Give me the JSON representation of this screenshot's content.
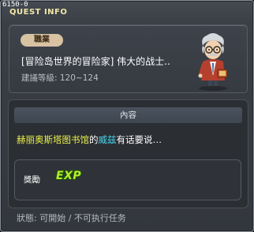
{
  "window": {
    "quest_id": "6150-0",
    "title": "QUEST INFO"
  },
  "quest": {
    "job_badge": "職業",
    "name": "[冒险岛世界的冒险家] 伟大的战士..",
    "level_req": "建議等級: 120~124",
    "npc_icon": "old-scholar-npc-icon"
  },
  "content": {
    "header": "內容",
    "text_parts": {
      "location": "赫丽奥斯塔图书馆",
      "connector": "的",
      "npc_name": "威兹",
      "tail": "有话要说…"
    },
    "reward_label": "獎勵",
    "reward_exp": "EXP"
  },
  "status": {
    "text": "狀態: 可開始 / 不可执行任务"
  },
  "colors": {
    "accent_yellow": "#e8ef4a",
    "accent_cyan": "#4ad6f0",
    "exp_green": "#b4ef2a",
    "badge_bg": "#d8c2a1"
  }
}
